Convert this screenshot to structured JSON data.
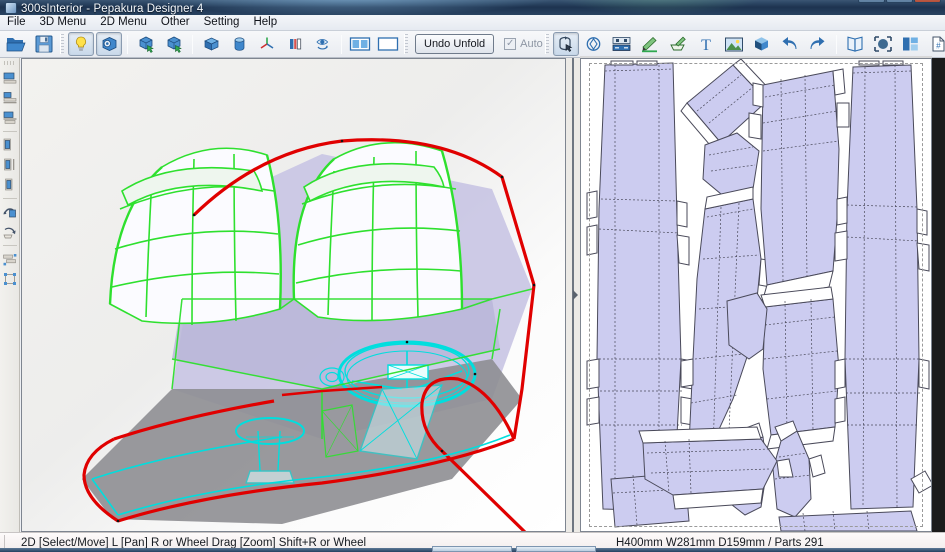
{
  "window": {
    "title": "300sInterior - Pepakura Designer 4",
    "minimize_label": "–",
    "maximize_label": "❐",
    "close_label": "✕"
  },
  "menubar": {
    "items": [
      {
        "label": "File"
      },
      {
        "label": "3D Menu"
      },
      {
        "label": "2D Menu"
      },
      {
        "label": "Other"
      },
      {
        "label": "Setting"
      },
      {
        "label": "Help"
      }
    ]
  },
  "toolbar": {
    "undo_unfold_label": "Undo Unfold",
    "auto_label": "Auto",
    "auto_checked_glyph": "✓",
    "buttons": [
      {
        "name": "open-file-icon",
        "tooltip": "Open",
        "pressed": false
      },
      {
        "name": "save-file-icon",
        "tooltip": "Save",
        "pressed": false
      },
      {
        "name": "lightbulb-icon",
        "tooltip": "Lighting",
        "pressed": true
      },
      {
        "name": "texture-cube-icon",
        "tooltip": "Texture",
        "pressed": true
      },
      {
        "name": "cube-select-icon",
        "tooltip": "Select Face",
        "pressed": false
      },
      {
        "name": "cube-select-alt-icon",
        "tooltip": "Select Part",
        "pressed": false
      },
      {
        "name": "box-shape-icon",
        "tooltip": "Box",
        "pressed": false
      },
      {
        "name": "cylinder-shape-icon",
        "tooltip": "Cylinder",
        "pressed": false
      },
      {
        "name": "axis-tripod-icon",
        "tooltip": "Axis",
        "pressed": false
      },
      {
        "name": "color-bars-icon",
        "tooltip": "Color",
        "pressed": false
      },
      {
        "name": "eye-rotate-icon",
        "tooltip": "View Rotate",
        "pressed": false
      },
      {
        "name": "split-view-icon",
        "tooltip": "Split View",
        "pressed": false
      },
      {
        "name": "single-view-icon",
        "tooltip": "Single View",
        "pressed": false
      },
      {
        "name": "move-rotate-icon",
        "tooltip": "Move / Rotate Part",
        "pressed": true
      },
      {
        "name": "rotate-part-icon",
        "tooltip": "Rotate Part",
        "pressed": false
      },
      {
        "name": "join-disconnect-icon",
        "tooltip": "Join / Disconnect",
        "pressed": false
      },
      {
        "name": "mountain-fold-icon",
        "tooltip": "Edit Fold Line",
        "pressed": false
      },
      {
        "name": "flap-edit-icon",
        "tooltip": "Edit Flap",
        "pressed": false
      },
      {
        "name": "text-tool-icon",
        "tooltip": "Add Text",
        "pressed": false
      },
      {
        "name": "image-tool-icon",
        "tooltip": "Add Image",
        "pressed": false
      },
      {
        "name": "solid-cube-icon",
        "tooltip": "3D Model",
        "pressed": false
      },
      {
        "name": "undo-icon",
        "tooltip": "Undo",
        "pressed": false
      },
      {
        "name": "redo-icon",
        "tooltip": "Redo",
        "pressed": false
      },
      {
        "name": "open-book-icon",
        "tooltip": "Unfold",
        "pressed": false
      },
      {
        "name": "fit-selection-icon",
        "tooltip": "Fit to Page",
        "pressed": false
      },
      {
        "name": "layout-grid-icon",
        "tooltip": "Auto Layout",
        "pressed": false
      },
      {
        "name": "page-number-icon",
        "tooltip": "Page Settings",
        "pressed": false
      },
      {
        "name": "export-page-icon",
        "tooltip": "Export",
        "pressed": false
      }
    ]
  },
  "left_toolbar": {
    "buttons": [
      {
        "name": "align-top-icon",
        "tooltip": "Align Top"
      },
      {
        "name": "align-middle-icon",
        "tooltip": "Align Middle"
      },
      {
        "name": "align-bottom-icon",
        "tooltip": "Align Bottom"
      },
      {
        "name": "align-left-icon",
        "tooltip": "Align Left"
      },
      {
        "name": "align-center-icon",
        "tooltip": "Align Center"
      },
      {
        "name": "align-right-icon",
        "tooltip": "Align Right"
      },
      {
        "name": "rotate-left-icon",
        "tooltip": "Rotate Left"
      },
      {
        "name": "rotate-right-icon",
        "tooltip": "Rotate Right"
      },
      {
        "name": "distribute-h-icon",
        "tooltip": "Distribute Horizontally"
      },
      {
        "name": "distribute-v-icon",
        "tooltip": "Distribute Vertically"
      }
    ]
  },
  "statusbar": {
    "left_text": "2D [Select/Move] L [Pan] R or Wheel Drag [Zoom] Shift+R or Wheel",
    "right_text": "H400mm W281mm D159mm / Parts 291"
  },
  "panels": {
    "view3d_name": "3d-model-view",
    "view2d_name": "2d-unfold-pattern-view",
    "splitter_arrow": "▸"
  },
  "colors": {
    "accent": "#2f6fb0",
    "model_face": "#c9c6e4",
    "model_edge_green": "#33e033",
    "model_edge_red": "#e00000",
    "model_edge_cyan": "#00e6e6",
    "pattern_fill": "#ccccf0",
    "pattern_stroke": "#4a4a5a",
    "titlebar": "#2f4a68"
  }
}
